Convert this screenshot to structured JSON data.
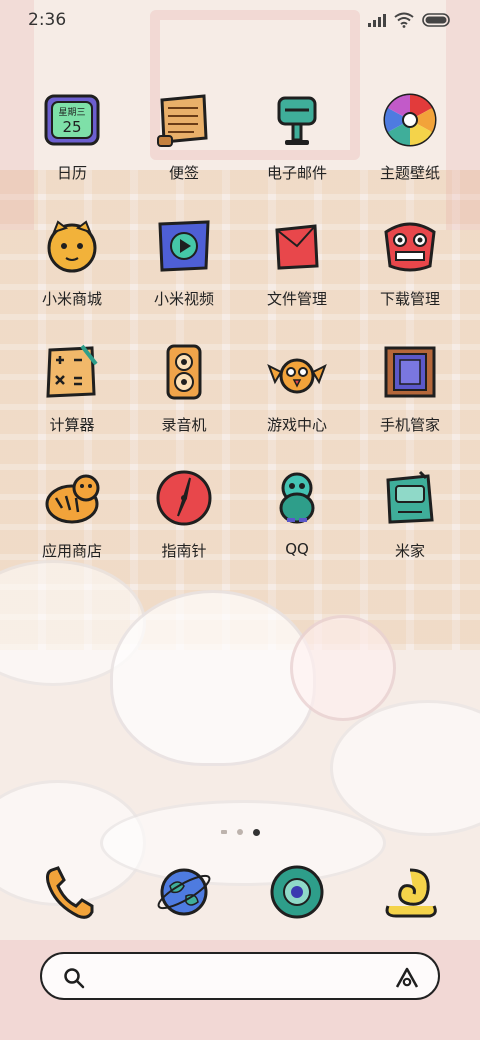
{
  "status_bar": {
    "time": "2:36",
    "icons": [
      "signal-icon",
      "wifi-icon",
      "battery-icon"
    ]
  },
  "home": {
    "apps": [
      {
        "label": "日历",
        "icon": "calendar-icon",
        "icon_text_top": "星期三",
        "icon_text_main": "25"
      },
      {
        "label": "便签",
        "icon": "notes-scroll-icon"
      },
      {
        "label": "电子邮件",
        "icon": "email-mailbox-icon"
      },
      {
        "label": "主题壁纸",
        "icon": "themes-palette-icon"
      },
      {
        "label": "小米商城",
        "icon": "mi-store-cat-icon"
      },
      {
        "label": "小米视频",
        "icon": "video-play-icon"
      },
      {
        "label": "文件管理",
        "icon": "file-manager-envelope-icon"
      },
      {
        "label": "下载管理",
        "icon": "download-lion-dance-icon"
      },
      {
        "label": "计算器",
        "icon": "calculator-icon"
      },
      {
        "label": "录音机",
        "icon": "recorder-speaker-icon"
      },
      {
        "label": "游戏中心",
        "icon": "game-center-bird-icon"
      },
      {
        "label": "手机管家",
        "icon": "security-frame-icon"
      },
      {
        "label": "应用商店",
        "icon": "app-store-tiger-icon"
      },
      {
        "label": "指南针",
        "icon": "compass-icon"
      },
      {
        "label": "QQ",
        "icon": "qq-penguin-icon"
      },
      {
        "label": "米家",
        "icon": "mi-home-icon"
      }
    ],
    "page_indicator": {
      "pages": 3,
      "active": 3
    }
  },
  "dock": [
    {
      "name": "phone",
      "icon": "phone-handset-icon"
    },
    {
      "name": "browser",
      "icon": "browser-globe-icon"
    },
    {
      "name": "camera",
      "icon": "camera-lens-icon"
    },
    {
      "name": "assistant",
      "icon": "swirl-cloud-icon"
    }
  ],
  "search_bar": {
    "left_icon": "search-icon",
    "right_icon": "assistant-a-icon"
  },
  "colors": {
    "outline": "#1f1f1f",
    "accent_orange": "#f2a33a",
    "accent_green": "#2e9e8a",
    "accent_red": "#e23b3b"
  }
}
